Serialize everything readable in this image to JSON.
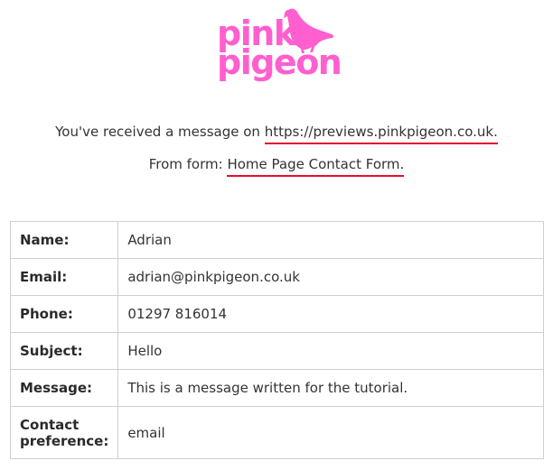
{
  "logo": {
    "line1": "pink",
    "line2": "pigeon",
    "icon": "pigeon-icon",
    "color": "#ff5fcf"
  },
  "intro": {
    "received_text": "You've received a message on ",
    "site_link": "https://previews.pinkpigeon.co.uk.",
    "from_text": "From form: ",
    "form_link": "Home Page Contact Form.",
    "underline_color": "#e0102a"
  },
  "details": {
    "rows": [
      {
        "label": "Name:",
        "value": "Adrian"
      },
      {
        "label": "Email:",
        "value": "adrian@pinkpigeon.co.uk"
      },
      {
        "label": "Phone:",
        "value": "01297 816014"
      },
      {
        "label": "Subject:",
        "value": "Hello"
      },
      {
        "label": "Message:",
        "value": "This is a message written for the tutorial."
      },
      {
        "label": "Contact preference:",
        "value": "email"
      }
    ]
  }
}
